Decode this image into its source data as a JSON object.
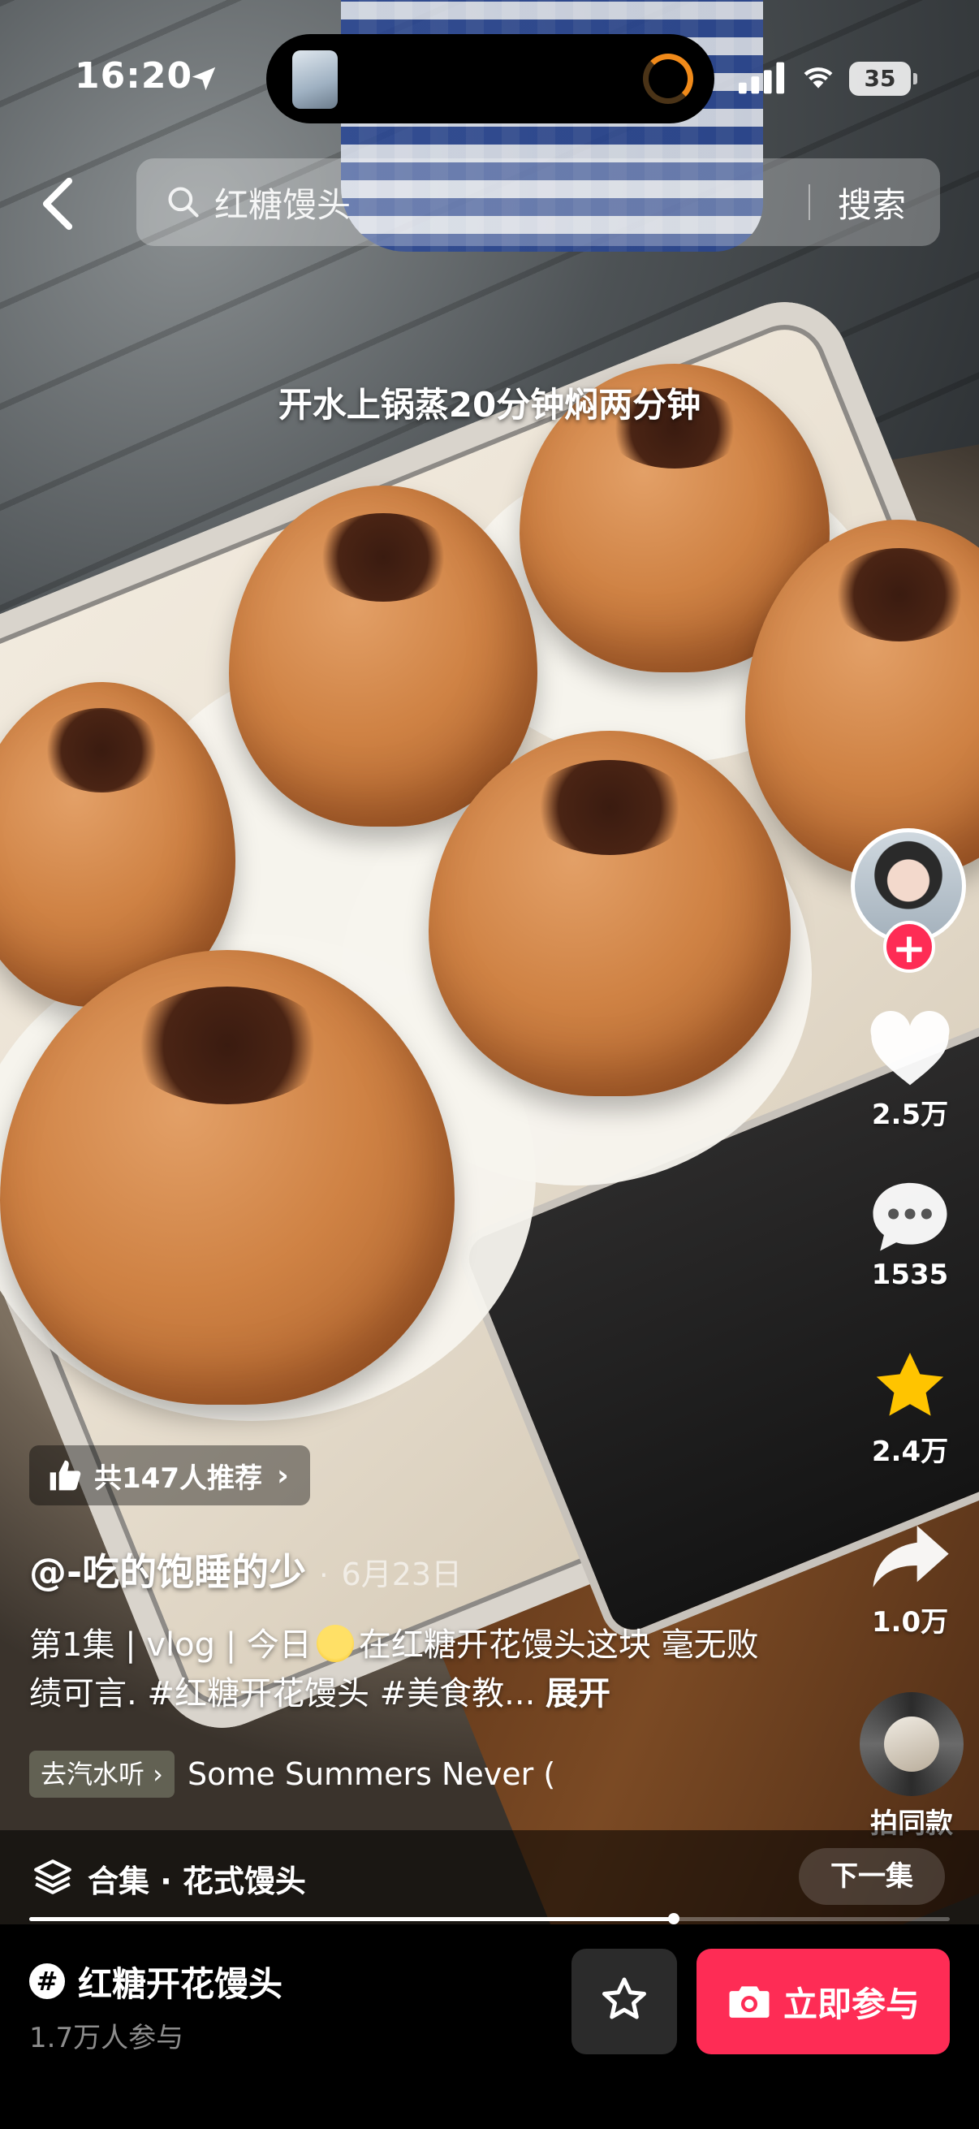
{
  "status_bar": {
    "time": "16:20",
    "battery": "35"
  },
  "search": {
    "query": "红糖馒头",
    "button_label": "搜索"
  },
  "video": {
    "caption": "开水上锅蒸20分钟焖两分钟"
  },
  "actions": {
    "likes": "2.5万",
    "comments": "1535",
    "favorites": "2.4万",
    "shares": "1.0万",
    "same_style_label": "拍同款"
  },
  "recommend": {
    "label": "共147人推荐"
  },
  "post": {
    "author": "@-吃的饱睡的少",
    "date": "6月23日",
    "description_part1": "第1集 | vlog | 今日",
    "description_part2": "在红糖开花馒头这块 毫无败绩可言. #红糖开花馒头 #美食教...",
    "expand_label": "展开"
  },
  "music": {
    "tag_label": "去汽水听 ›",
    "title": "Some Summers Never ("
  },
  "playlist": {
    "title": "合集 · 花式馒头",
    "next_label": "下一集",
    "progress": 0.7
  },
  "topic": {
    "hash": "#",
    "title": "红糖开花馒头",
    "participants": "1.7万人参与",
    "join_label": "立即参与"
  },
  "colors": {
    "accent": "#fe2c55",
    "favorite_star": "#ffc400"
  },
  "icons": [
    "location-arrow-icon",
    "signal-icon",
    "wifi-icon",
    "back-icon",
    "search-icon",
    "heart-icon",
    "comment-icon",
    "star-icon",
    "share-icon",
    "thumbs-up-icon",
    "layers-icon",
    "hashtag-icon",
    "camera-icon"
  ]
}
